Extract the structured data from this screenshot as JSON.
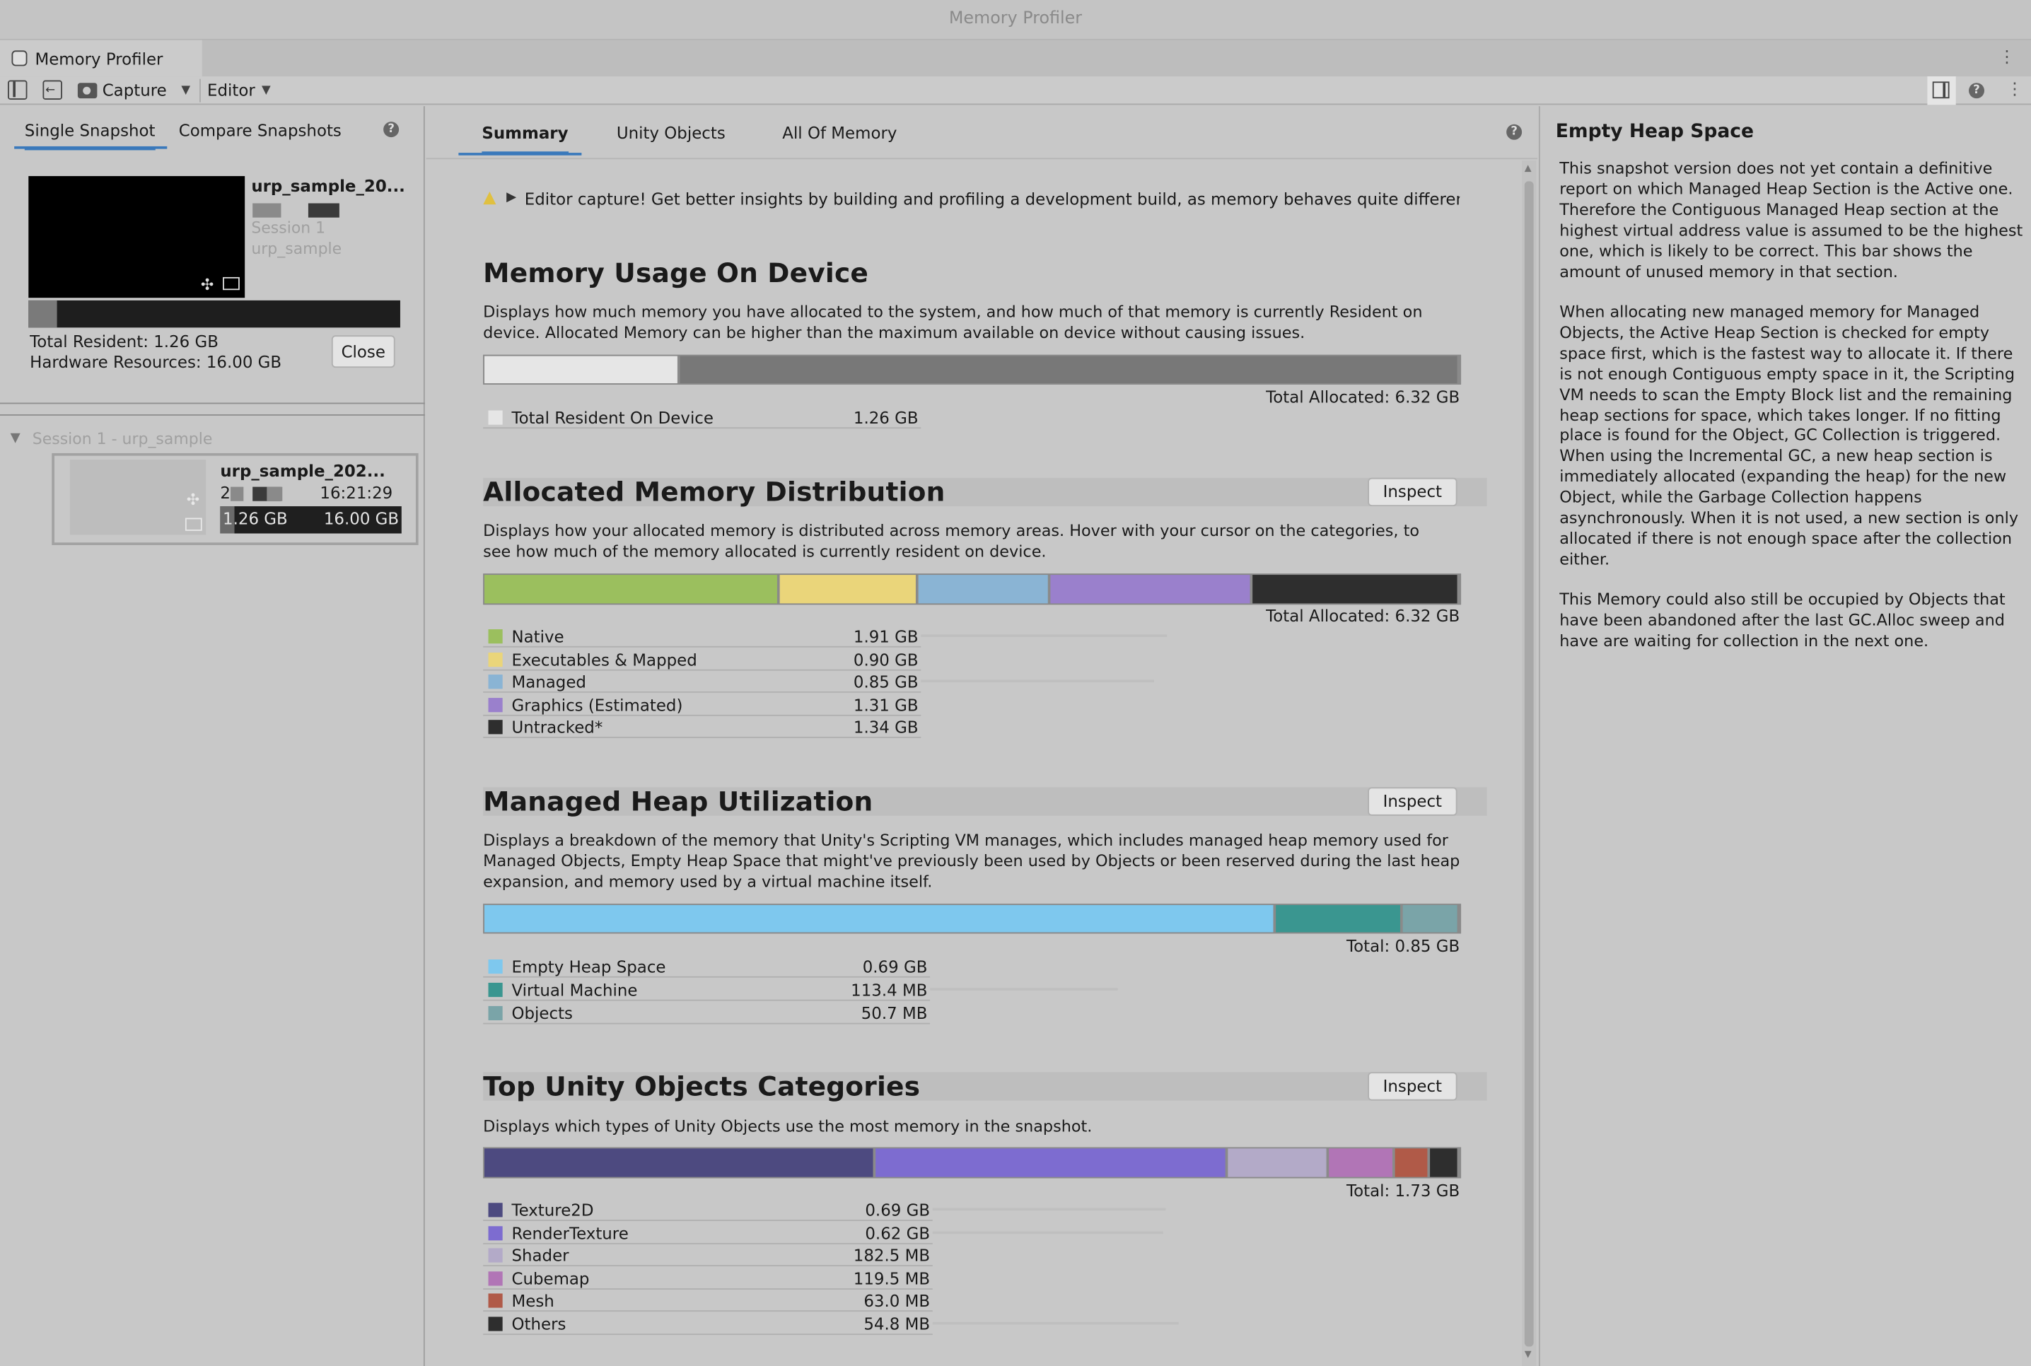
{
  "window": {
    "title": "Memory Profiler",
    "tab_label": "Memory Profiler"
  },
  "toolbar": {
    "capture_label": "Capture",
    "editor_label": "Editor"
  },
  "left": {
    "tabs": [
      {
        "label": "Single Snapshot",
        "active": true
      },
      {
        "label": "Compare Snapshots",
        "active": false
      }
    ],
    "snapshot": {
      "name": "urp_sample_20...",
      "session": "Session 1",
      "project": "urp_sample",
      "resident_fraction": 0.077
    },
    "total_resident": "Total Resident: 1.26 GB",
    "hardware_resources": "Hardware Resources: 16.00 GB",
    "close_label": "Close",
    "session_header": "Session 1 - urp_sample",
    "snapshot_item": {
      "name": "urp_sample_202...",
      "time": "16:21:29",
      "date_prefix": "2",
      "used": "1.26 GB",
      "total": "16.00 GB"
    }
  },
  "center": {
    "tabs": [
      {
        "label": "Summary",
        "active": true
      },
      {
        "label": "Unity Objects",
        "active": false
      },
      {
        "label": "All Of Memory",
        "active": false
      }
    ],
    "notice": "Editor capture! Get better insights by building and profiling a development build, as memory behaves quite differently",
    "inspect_label": "Inspect",
    "sections": {
      "usage": {
        "title": "Memory Usage On Device",
        "desc": "Displays how much memory you have allocated to the system, and how much of that memory is currently Resident on device. Allocated Memory can be higher than the maximum available on device without causing issues.",
        "total": "Total Allocated: 6.32 GB",
        "legend": [
          {
            "name": "Total Resident On Device",
            "value": "1.26 GB",
            "color": "#e6e6e6"
          }
        ],
        "bar": [
          {
            "fraction": 0.2,
            "color": "#e6e6e6"
          },
          {
            "fraction": 0.8,
            "color": "#787878"
          }
        ]
      },
      "distribution": {
        "title": "Allocated Memory Distribution",
        "desc": "Displays how your allocated memory is distributed across memory areas. Hover with your cursor on the categories, to see how much of the memory allocated is currently resident on device.",
        "total": "Total Allocated: 6.32 GB",
        "legend": [
          {
            "name": "Native",
            "value": "1.91 GB",
            "color": "#9bbf5e"
          },
          {
            "name": "Executables & Mapped",
            "value": "0.90 GB",
            "color": "#ead57a"
          },
          {
            "name": "Managed",
            "value": "0.85 GB",
            "color": "#8ab4d4"
          },
          {
            "name": "Graphics (Estimated)",
            "value": "1.31 GB",
            "color": "#9a80cc"
          },
          {
            "name": "Untracked*",
            "value": "1.34 GB",
            "color": "#2e2e2e"
          }
        ]
      },
      "heap": {
        "title": "Managed Heap Utilization",
        "desc": "Displays a breakdown of the memory that Unity's Scripting VM manages, which includes managed heap memory used for Managed Objects, Empty Heap Space that might've previously been used by Objects or been reserved during the last heap expansion, and memory used by a virtual machine itself.",
        "total": "Total: 0.85 GB",
        "legend": [
          {
            "name": "Empty Heap Space",
            "value": "0.69 GB",
            "color": "#7ec8ee"
          },
          {
            "name": "Virtual Machine",
            "value": "113.4 MB",
            "color": "#3a9690"
          },
          {
            "name": "Objects",
            "value": "50.7 MB",
            "color": "#7aa4a8"
          }
        ]
      },
      "objects": {
        "title": "Top Unity Objects Categories",
        "desc": "Displays which types of Unity Objects use the most memory in the snapshot.",
        "total": "Total: 1.73 GB",
        "legend": [
          {
            "name": "Texture2D",
            "value": "0.69 GB",
            "color": "#4d4a80"
          },
          {
            "name": "RenderTexture",
            "value": "0.62 GB",
            "color": "#7d6cd0"
          },
          {
            "name": "Shader",
            "value": "182.5 MB",
            "color": "#b3aac8"
          },
          {
            "name": "Cubemap",
            "value": "119.5 MB",
            "color": "#b175b6"
          },
          {
            "name": "Mesh",
            "value": "63.0 MB",
            "color": "#b05a48"
          },
          {
            "name": "Others",
            "value": "54.8 MB",
            "color": "#2e2e2e"
          }
        ]
      }
    }
  },
  "right": {
    "title": "Empty Heap Space",
    "paragraphs": [
      "This snapshot version does not yet contain a definitive report on which Managed Heap Section is the Active one. Therefore the Contiguous Managed Heap section at the highest virtual address value is assumed to be the highest one, which is likely to be correct. This bar shows the amount of unused memory in that section.",
      "When allocating new managed memory for Managed Objects, the Active Heap Section is checked for empty space first, which is the fastest way to allocate it. If there is not enough Contiguous empty space in it, the Scripting VM needs to scan the Empty Block list and the remaining heap sections for space, which takes longer. If no fitting place is found for the Object, GC Collection is triggered. When using the Incremental GC, a new heap section is immediately allocated (expanding the heap) for the new Object, while the Garbage Collection happens asynchronously. When it is not used, a new section is only allocated if there is not enough space after the collection either.",
      "This Memory could also still be occupied by Objects that have been abandoned after the last GC.Alloc sweep and have are waiting for collection in the next one."
    ]
  },
  "icons": [
    "window-icon",
    "sidebar-toggle-icon",
    "import-icon",
    "camera-icon",
    "help-icon",
    "inspector-toggle-icon",
    "kebab-icon",
    "warning-icon",
    "unity-logo-icon",
    "monitor-icon"
  ]
}
